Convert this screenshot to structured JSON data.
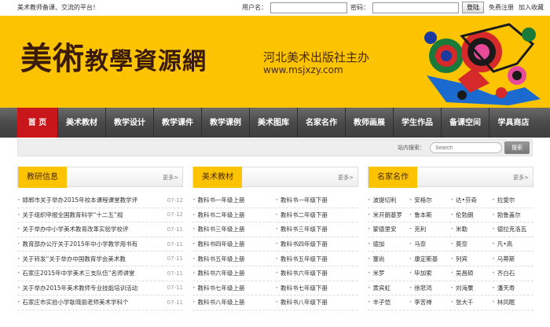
{
  "top": {
    "slogan": "美术教师备课、交流的平台！",
    "username_label": "用户名：",
    "password_label": "密码：",
    "login_button": "登陆",
    "register": "免费注册",
    "favorite": "加入收藏"
  },
  "banner": {
    "logo_part1": "美術",
    "logo_part2": "教學資源網",
    "publisher": "河北美术出版社主办",
    "url": "www.msjxzy.com"
  },
  "nav": [
    "首 页",
    "美术教材",
    "教学设计",
    "教学课件",
    "教学课例",
    "美术图库",
    "名家名作",
    "教师画展",
    "学生作品",
    "备课空间",
    "学具商店"
  ],
  "search": {
    "label": "站内搜索：",
    "placeholder": "Search",
    "button": "搜索"
  },
  "columns": {
    "research": {
      "title": "教研信息",
      "more": "更多>",
      "items": [
        {
          "t": "邯郸市关于举办2015年校本课程课堂教学评",
          "d": "07-12"
        },
        {
          "t": "关于组织申报全国教育科学“十二五”规",
          "d": "07-12"
        },
        {
          "t": "关于举办中小学美术教育改革实验学校评",
          "d": "07-11"
        },
        {
          "t": "教育部办公厅关于2015年中小学教学用书有",
          "d": "07-11"
        },
        {
          "t": "关于转发“关于举办中国教育学会美术教",
          "d": "07-11"
        },
        {
          "t": "石家庄2015年中学美术三支队伍“名师讲堂",
          "d": "07-11"
        },
        {
          "t": "关于举办2015年美术教师专业技能培训活动",
          "d": "07-11"
        },
        {
          "t": "石家庄市实验小学耿晓丽老师美术学科个",
          "d": "07-11"
        }
      ]
    },
    "textbooks": {
      "title": "美术教材",
      "more": "更多>",
      "items": [
        [
          "教科书一年级上册",
          "教科书一年级下册"
        ],
        [
          "教科书二年级上册",
          "教科书二年级下册"
        ],
        [
          "教科书三年级上册",
          "教科书三年级下册"
        ],
        [
          "教科书四年级上册",
          "教科书四年级下册"
        ],
        [
          "教科书五年级上册",
          "教科书五年级下册"
        ],
        [
          "教科书六年级上册",
          "教科书六年级下册"
        ],
        [
          "教科书七年级上册",
          "教科书七年级下册"
        ],
        [
          "教科书八年级上册",
          "教科书八年级下册"
        ]
      ]
    },
    "masters": {
      "title": "名家名作",
      "more": "更多>",
      "items": [
        [
          "波提切利",
          "安格尔",
          "达•芬奇",
          "拉斐尔"
        ],
        [
          "米开朗基罗",
          "鲁本斯",
          "伦勃朗",
          "勃鲁盖尔"
        ],
        [
          "蒙德里安",
          "克利",
          "米勒",
          "德拉克洛瓦"
        ],
        [
          "德加",
          "马奈",
          "莫奈",
          "凡•高"
        ],
        [
          "塞尚",
          "康定斯基",
          "列宾",
          "马蒂斯"
        ],
        [
          "米罗",
          "毕加索",
          "吴昌硕",
          "齐白石"
        ],
        [
          "黄宾虹",
          "徐悲鸿",
          "刘海粟",
          "潘天寿"
        ],
        [
          "丰子恺",
          "李苦禅",
          "张大千",
          "林风眠"
        ]
      ]
    }
  },
  "colors": {
    "brand_yellow": "#fcc400",
    "nav_active": "#c8161b",
    "nav_bg": "#4a4a4a"
  }
}
